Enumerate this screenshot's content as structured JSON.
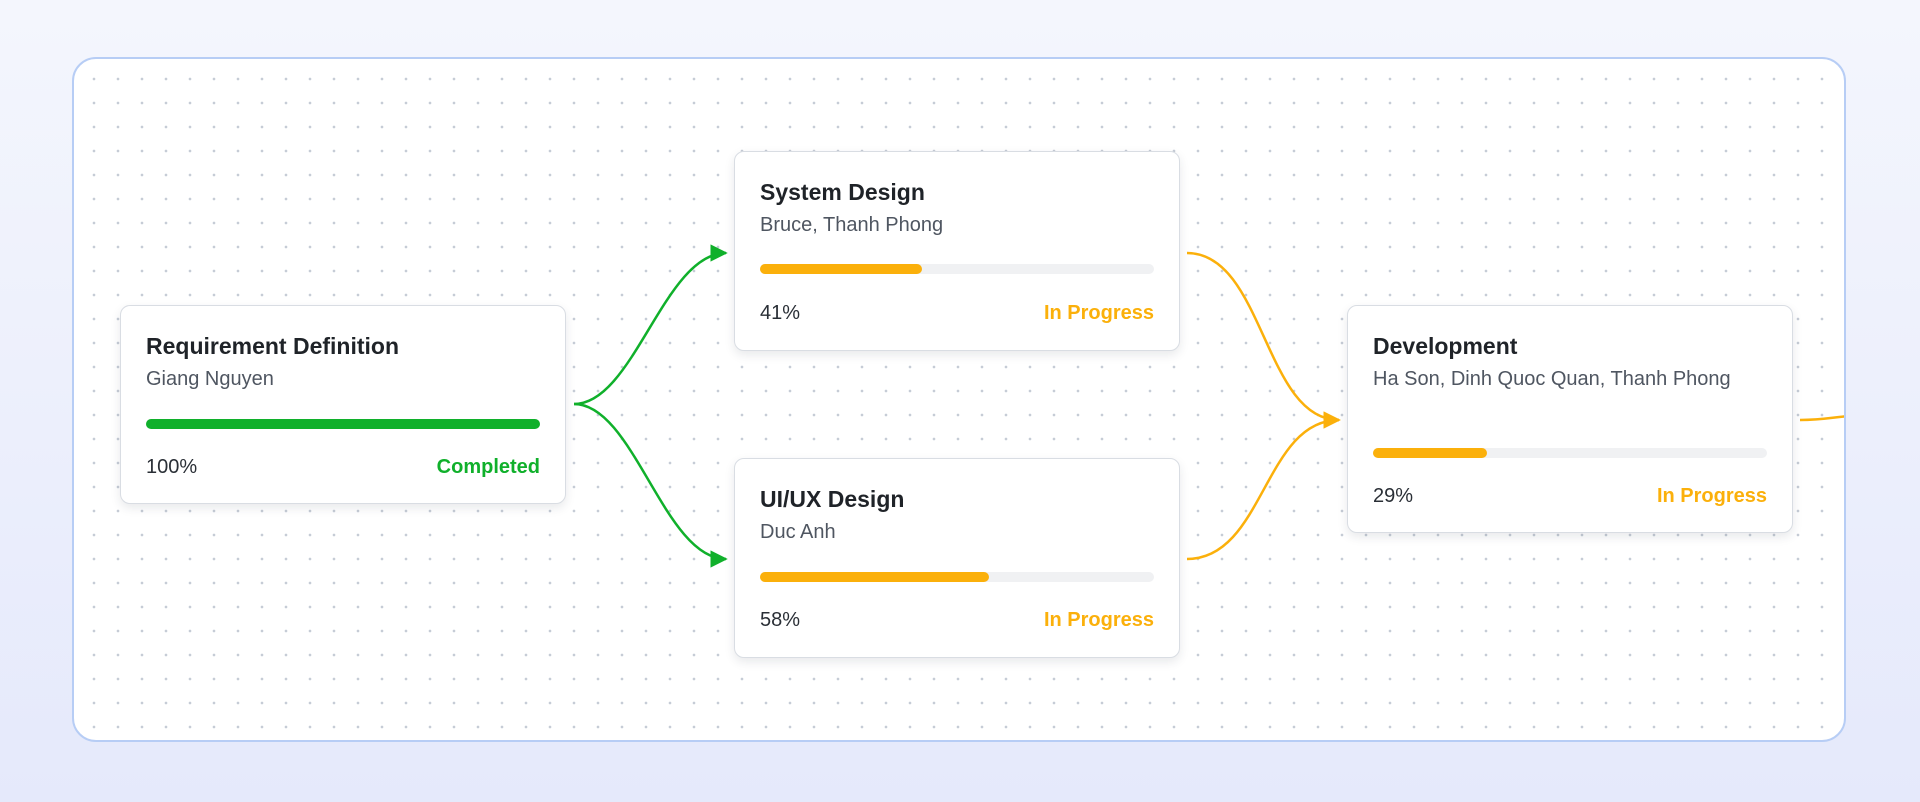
{
  "colors": {
    "completed": "#10b02b",
    "in_progress": "#fbb00b",
    "canvas_border": "#b7cdf5"
  },
  "nodes": [
    {
      "id": "requirement-definition",
      "title": "Requirement Definition",
      "assignees": "Giang Nguyen",
      "progress": 1.0,
      "percent_label": "100%",
      "status": "Completed",
      "state": "completed"
    },
    {
      "id": "system-design",
      "title": "System Design",
      "assignees": "Bruce, Thanh Phong",
      "progress": 0.41,
      "percent_label": "41%",
      "status": "In Progress",
      "state": "in_progress"
    },
    {
      "id": "uiux-design",
      "title": "UI/UX Design",
      "assignees": "Duc Anh",
      "progress": 0.58,
      "percent_label": "58%",
      "status": "In Progress",
      "state": "in_progress"
    },
    {
      "id": "development",
      "title": "Development",
      "assignees": "Ha Son, Dinh Quoc Quan, Thanh Phong",
      "progress": 0.29,
      "percent_label": "29%",
      "status": "In Progress",
      "state": "in_progress"
    }
  ],
  "edges": [
    {
      "from": "requirement-definition",
      "to": "system-design",
      "state": "completed"
    },
    {
      "from": "requirement-definition",
      "to": "uiux-design",
      "state": "completed"
    },
    {
      "from": "system-design",
      "to": "development",
      "state": "in_progress"
    },
    {
      "from": "uiux-design",
      "to": "development",
      "state": "in_progress"
    },
    {
      "from": "development",
      "to": "next",
      "state": "in_progress"
    }
  ]
}
